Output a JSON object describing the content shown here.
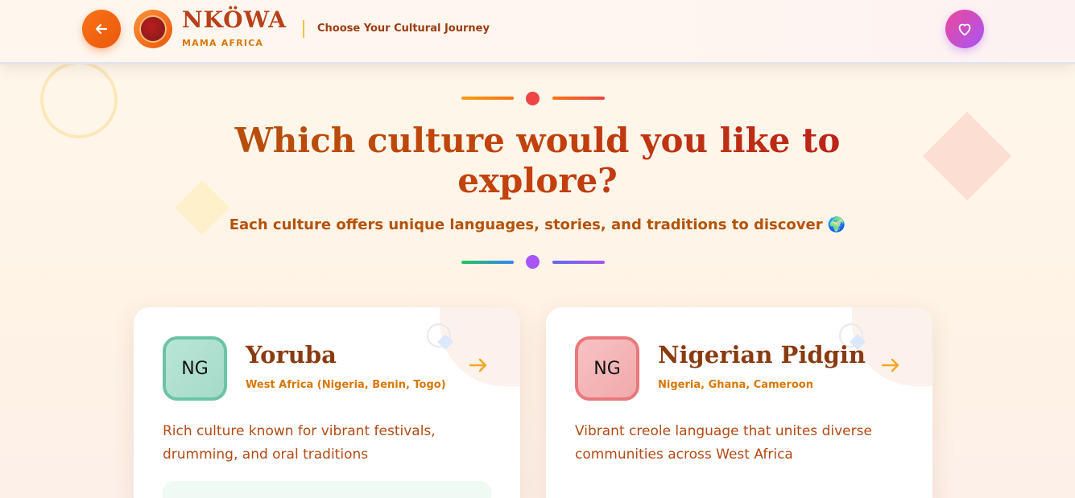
{
  "header": {
    "back_icon": "arrow-left-icon",
    "brand_name": "NKÖWA",
    "brand_subtitle": "MAMA AFRICA",
    "tagline": "Choose Your Cultural Journey",
    "favorite_icon": "heart-icon"
  },
  "hero": {
    "title": "Which culture would you like to explore?",
    "subtitle": "Each culture offers unique languages, stories, and traditions to discover 🌍"
  },
  "cultures": [
    {
      "code": "NG",
      "name": "Yoruba",
      "region": "West Africa (Nigeria, Benin, Togo)",
      "description": "Rich culture known for vibrant festivals, drumming, and oral traditions",
      "note": "",
      "badge_color": "#6cc3a6",
      "arrow_icon": "arrow-right-icon"
    },
    {
      "code": "NG",
      "name": "Nigerian Pidgin",
      "region": "Nigeria, Ghana, Cameroon",
      "description": "Vibrant creole language that unites diverse communities across West Africa",
      "badge_color": "#e8787c",
      "arrow_icon": "arrow-right-icon"
    }
  ],
  "colors": {
    "accent_orange": "#f97316",
    "accent_purple": "#a855f7",
    "title_brown": "#b8401a"
  }
}
